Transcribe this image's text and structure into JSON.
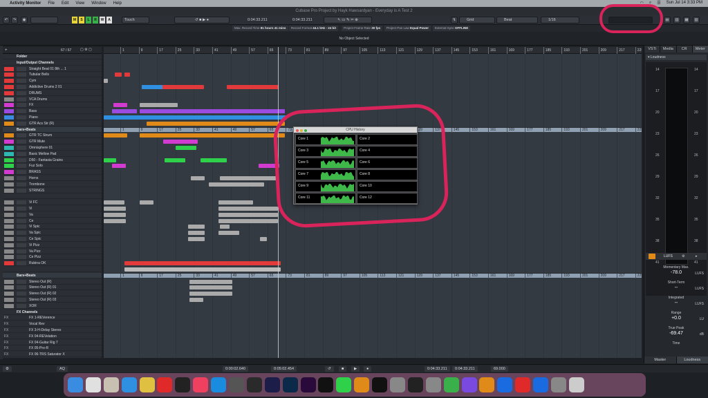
{
  "menubar": {
    "apple": "",
    "app_name": "Activity Monitor",
    "items": [
      "File",
      "Edit",
      "View",
      "Window",
      "Help"
    ],
    "clock": "Sun Jul 14  3:33 PM"
  },
  "window": {
    "title": "Cubase Pro Project by Hayk Hawsardyan - Everyday is A Test 2"
  },
  "toolbar": {
    "touch_label": "Touch",
    "position_left": "0:04:33.211",
    "position_right": "0:04:33.211",
    "grid_label": "Grid",
    "quantize_label": "Beat",
    "quantize_value": "1/16",
    "m_labels": [
      "M",
      "S",
      "L",
      "R",
      "W",
      "A"
    ]
  },
  "status": {
    "items": [
      {
        "label": "Max. Record Time",
        "value": "81 hours 41 mins"
      },
      {
        "label": "Record Format",
        "value": "44.1 kHz - 24 bit"
      },
      {
        "label": "Project Frame Rate",
        "value": "30 fps"
      },
      {
        "label": "Project Pan Law",
        "value": "Equal Power"
      },
      {
        "label": "External Sync",
        "value": "OFFLINE"
      }
    ]
  },
  "info_line": "No Object Selected",
  "track_header": {
    "count": "67 / 67"
  },
  "tracks": [
    {
      "name": "Folder",
      "kind": "folder"
    },
    {
      "name": "Input/Output Channels",
      "kind": "folder"
    },
    {
      "name": "Straight Beat 01 8th ... 1",
      "kind": "track",
      "color": "#e23a3a"
    },
    {
      "name": "Tubular Bells",
      "kind": "track",
      "color": "#e23a3a"
    },
    {
      "name": "Cym",
      "kind": "track",
      "color": "#e23a3a"
    },
    {
      "name": "Addictive Drums 2 01",
      "kind": "track",
      "color": "#e23a3a"
    },
    {
      "name": "DRUMS",
      "kind": "track",
      "color": "#e23a3a"
    },
    {
      "name": "VCA Drums",
      "kind": "track",
      "color": "#888"
    },
    {
      "name": "FX",
      "kind": "track",
      "color": "#d23bd0"
    },
    {
      "name": "Bass",
      "kind": "track",
      "color": "#9b4be0"
    },
    {
      "name": "Piano",
      "kind": "track",
      "color": "#3a8ce0"
    },
    {
      "name": "GTR Acs Str (R)",
      "kind": "track",
      "color": "#e08a1a"
    },
    {
      "name": "Bars+Beats",
      "kind": "ruler"
    },
    {
      "name": "GTR TC Strum",
      "kind": "track",
      "color": "#e08a1a"
    },
    {
      "name": "GTR Mute",
      "kind": "track",
      "color": "#d23bd0"
    },
    {
      "name": "Omnisphere 01",
      "kind": "track",
      "color": "#2fb8b0"
    },
    {
      "name": "Basic Mellow Pad",
      "kind": "track",
      "color": "#2fb8b0"
    },
    {
      "name": "D50 - Fantasia Grains",
      "kind": "track",
      "color": "#2fd04a"
    },
    {
      "name": "Fuz Solo",
      "kind": "track",
      "color": "#2fd04a"
    },
    {
      "name": "BRASS",
      "kind": "track",
      "color": "#d23bd0"
    },
    {
      "name": "Horns",
      "kind": "track",
      "color": "#888"
    },
    {
      "name": "Trombone",
      "kind": "track",
      "color": "#888"
    },
    {
      "name": "STRINGS",
      "kind": "track",
      "color": "#888"
    },
    {
      "name": "",
      "kind": "blank"
    },
    {
      "name": "Vi FC",
      "kind": "track",
      "color": "#888"
    },
    {
      "name": "Vi",
      "kind": "track",
      "color": "#888"
    },
    {
      "name": "Va",
      "kind": "track",
      "color": "#888"
    },
    {
      "name": "Ce",
      "kind": "track",
      "color": "#888"
    },
    {
      "name": "Vi Spic",
      "kind": "track",
      "color": "#888"
    },
    {
      "name": "Va Spic",
      "kind": "track",
      "color": "#888"
    },
    {
      "name": "Ce Spic",
      "kind": "track",
      "color": "#888"
    },
    {
      "name": "Vi Pizz",
      "kind": "track",
      "color": "#888"
    },
    {
      "name": "Va Pizz",
      "kind": "track",
      "color": "#888"
    },
    {
      "name": "Ce Pizz",
      "kind": "track",
      "color": "#888"
    },
    {
      "name": "Rubina OK",
      "kind": "track",
      "color": "#e23a3a"
    },
    {
      "name": "",
      "kind": "blank"
    },
    {
      "name": "Bars+Beats",
      "kind": "ruler"
    },
    {
      "name": "Stereo Out (R)",
      "kind": "track",
      "color": "#888"
    },
    {
      "name": "Stereo Out (R) 01",
      "kind": "track",
      "color": "#888"
    },
    {
      "name": "Stereo Out (R) 02",
      "kind": "track",
      "color": "#888"
    },
    {
      "name": "Stereo Out (R) 03",
      "kind": "track",
      "color": "#888"
    },
    {
      "name": "XOR",
      "kind": "track",
      "color": "#888"
    },
    {
      "name": "FX Channels",
      "kind": "folder"
    },
    {
      "name": "FX 1-REVerence",
      "kind": "fx"
    },
    {
      "name": "Vocal Rev",
      "kind": "fx"
    },
    {
      "name": "FX 3-H-Delay Stereo",
      "kind": "fx"
    },
    {
      "name": "FX 04-REVelation",
      "kind": "fx"
    },
    {
      "name": "FX 04-Guitar Rig 7",
      "kind": "fx"
    },
    {
      "name": "FX 05-Pro-R",
      "kind": "fx"
    },
    {
      "name": "FX 06-TRS Saturator X",
      "kind": "fx"
    }
  ],
  "ruler_ticks": [
    "1",
    "9",
    "17",
    "25",
    "33",
    "41",
    "49",
    "57",
    "65",
    "73",
    "81",
    "89",
    "97",
    "105",
    "113",
    "121",
    "129",
    "137",
    "145",
    "153",
    "161",
    "169",
    "177",
    "185",
    "193",
    "201",
    "209",
    "217",
    "225",
    "233"
  ],
  "cpu_history": {
    "title": "CPU History",
    "cores": [
      "Core 1",
      "Core 2",
      "Core 3",
      "Core 4",
      "Core 5",
      "Core 6",
      "Core 7",
      "Core 8",
      "Core 9",
      "Core 10",
      "Core 11",
      "Core 12"
    ]
  },
  "right_panel": {
    "tabs": [
      "VSTi",
      "Media",
      "CR",
      "Meter"
    ],
    "loudness_label": "Loudness",
    "scale": [
      "14",
      "17",
      "20",
      "23",
      "26",
      "29",
      "32",
      "35",
      "38",
      "41"
    ],
    "lufs_label": "LUFS",
    "stats": [
      {
        "label": "Momentary Max.",
        "value": "-78.0",
        "unit": "LUFS"
      },
      {
        "label": "Short-Term",
        "value": "--",
        "unit": "LUFS"
      },
      {
        "label": "Integrated",
        "value": "--",
        "unit": "LUFS"
      },
      {
        "label": "Range",
        "value": "+0.0",
        "unit": "LU"
      },
      {
        "label": "True Peak",
        "value": "-69.47",
        "unit": "dB"
      },
      {
        "label": "Time",
        "value": "",
        "unit": ""
      }
    ],
    "bottom_tabs": [
      "Master",
      "Loudness"
    ]
  },
  "transport": {
    "left_locator": "0:00:02.640",
    "right_locator": "0:05:02.454",
    "position": "0:04:33.211",
    "position2": "0:04:33.211",
    "tempo": "69.000"
  },
  "dock": [
    "Finder",
    "Launchpad",
    "Preview",
    "Safari",
    "Chrome",
    "Cubase",
    "Ableton",
    "Music",
    "App Store",
    "Logic",
    "Capture",
    "Au",
    "Ps",
    "Pr",
    "Final Cut",
    "Messages",
    "Arturia",
    "KT",
    "Settings",
    "Terminal",
    "Monitor",
    "Maps",
    "Viber",
    "Books",
    "TeamViewer",
    "Kontakt",
    "Windows",
    "Screenshot",
    "Trash"
  ]
}
